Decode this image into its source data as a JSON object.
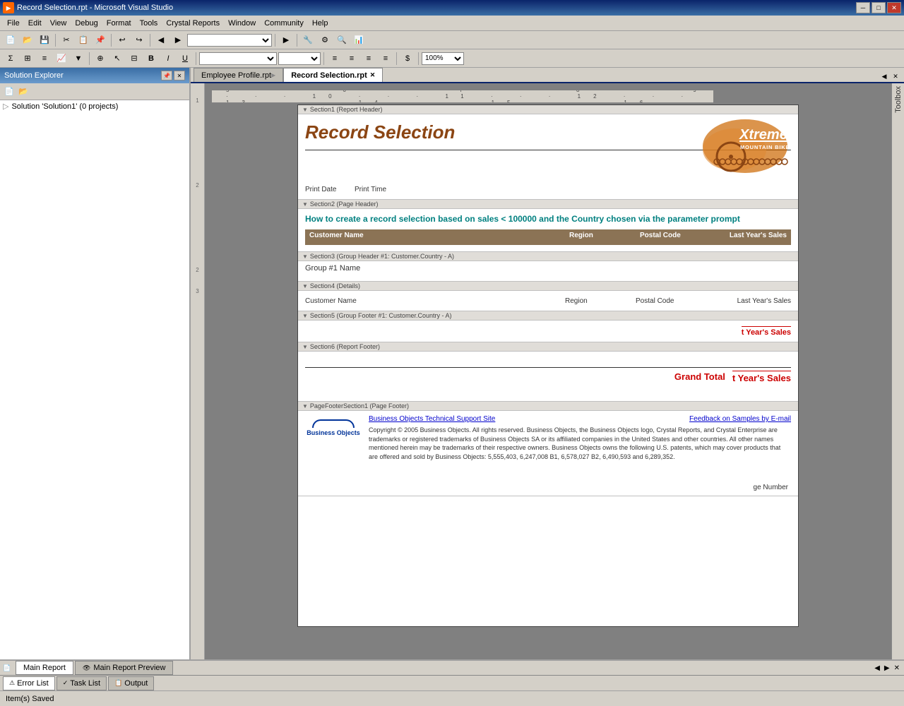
{
  "window": {
    "title": "Record Selection.rpt - Microsoft Visual Studio",
    "icon": "VS"
  },
  "titlebar": {
    "title": "Record Selection.rpt - Microsoft Visual Studio",
    "min_label": "─",
    "restore_label": "□",
    "close_label": "✕"
  },
  "menubar": {
    "items": [
      "File",
      "Edit",
      "View",
      "Debug",
      "Format",
      "Tools",
      "Crystal Reports",
      "Window",
      "Community",
      "Help"
    ]
  },
  "toolbar1": {
    "zoom_value": "100%"
  },
  "solution_explorer": {
    "title": "Solution Explorer",
    "solution_label": "Solution 'Solution1' (0 projects)"
  },
  "tabs": {
    "inactive_tab": "Employee Profile.rpt",
    "active_tab": "Record Selection.rpt"
  },
  "report": {
    "sections": {
      "report_header": {
        "label": "Section1 (Report Header)",
        "title": "Record Selection",
        "print_date": "Print Date",
        "print_time": "Print Time"
      },
      "page_header": {
        "label": "Section2 (Page Header)",
        "subtitle": "How to create a record selection based on sales < 100000 and the Country chosen via the parameter prompt",
        "columns": [
          "Customer Name",
          "Region",
          "Postal Code",
          "Last Year's Sales"
        ]
      },
      "group_header": {
        "label": "Section3 (Group Header #1: Customer.Country - A)",
        "group_name": "Group #1 Name"
      },
      "details": {
        "label": "Section4 (Details)",
        "fields": [
          "Customer Name",
          "Region",
          "Postal Code",
          "Last Year's Sales"
        ]
      },
      "group_footer": {
        "label": "Section5 (Group Footer #1: Customer.Country - A)",
        "total_label": "t Year's Sales"
      },
      "report_footer": {
        "label": "Section6 (Report Footer)",
        "grand_total_label": "Grand Total",
        "grand_total_value": "t Year's Sales"
      },
      "page_footer": {
        "label": "PageFooterSection1 (Page Footer)",
        "bo_logo": "Business Objects",
        "link1": "Business Objects Technical Support Site",
        "link2": "Feedback on Samples by E-mail",
        "copyright": "Copyright © 2005 Business Objects. All rights reserved. Business Objects, the Business Objects logo, Crystal Reports, and Crystal Enterprise are trademarks or registered trademarks of Business Objects SA or its affiliated companies in the United States and other countries.  All other names mentioned herein may be trademarks of their respective owners. Business Objects owns the following U.S. patents, which may cover products that are offered and sold by Business Objects: 5,555,403, 6,247,008 B1, 6,578,027 B2, 6,490,593 and 6,289,352.",
        "page_number_label": "ge Number"
      }
    }
  },
  "bottom_tabs": {
    "main_report": "Main Report",
    "main_report_preview": "Main Report Preview"
  },
  "bottom_panel": {
    "tabs": [
      "Error List",
      "Task List",
      "Output"
    ]
  },
  "status_bar": {
    "message": "Item(s) Saved"
  },
  "toolbox": {
    "label": "Toolbox"
  },
  "xtreme": {
    "text1": "reme",
    "text2": "MOUNTAIN BIKE, INC."
  }
}
